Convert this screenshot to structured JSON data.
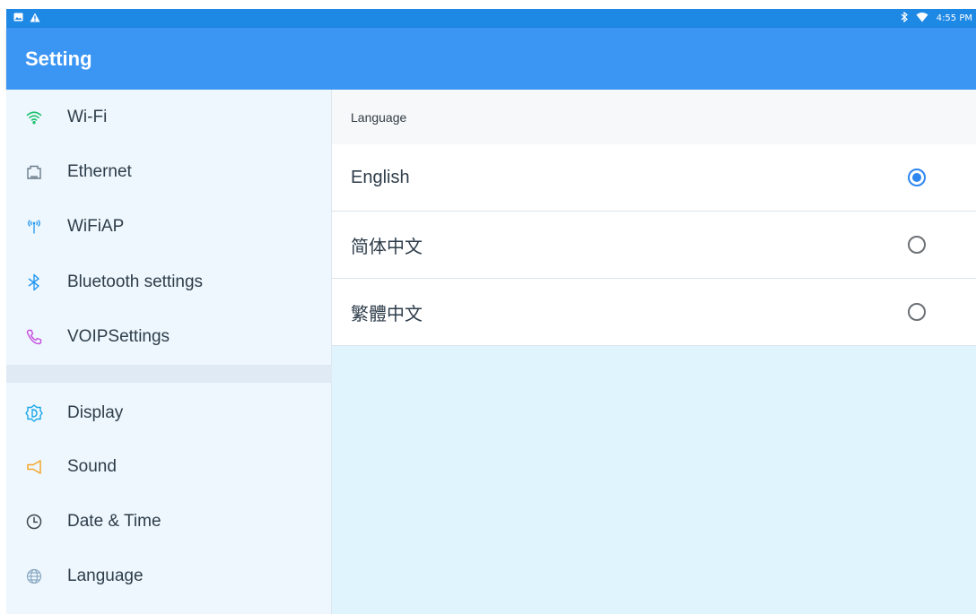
{
  "status_bar": {
    "left_icons": [
      "image-notification-icon",
      "warning-icon"
    ],
    "right_icons": [
      "bluetooth-icon",
      "wifi-signal-icon"
    ],
    "time": "4:55 PM"
  },
  "app_bar": {
    "title": "Setting"
  },
  "sidebar": {
    "items": [
      {
        "label": "Wi-Fi",
        "icon": "wifi-icon",
        "color": "#1ec26e"
      },
      {
        "label": "Ethernet",
        "icon": "ethernet-icon",
        "color": "#6b7b8a"
      },
      {
        "label": "WiFiAP",
        "icon": "hotspot-icon",
        "color": "#2196f3"
      },
      {
        "label": "Bluetooth settings",
        "icon": "bluetooth-icon",
        "color": "#2196f3"
      },
      {
        "label": "VOIPSettings",
        "icon": "phone-icon",
        "color": "#c64ee0"
      },
      {
        "label": "Display",
        "icon": "display-icon",
        "color": "#1aa7e8"
      },
      {
        "label": "Sound",
        "icon": "sound-icon",
        "color": "#f4a52a"
      },
      {
        "label": "Date & Time",
        "icon": "clock-icon",
        "color": "#3a4650"
      },
      {
        "label": "Language",
        "icon": "globe-icon",
        "color": "#8aa8c2"
      }
    ]
  },
  "content": {
    "section_title": "Language",
    "options": [
      {
        "label": "English",
        "selected": true
      },
      {
        "label": "简体中文",
        "selected": false
      },
      {
        "label": "繁體中文",
        "selected": false
      }
    ]
  },
  "colors": {
    "status_bar": "#1e88e5",
    "app_bar": "#3b96f3",
    "sidebar_bg": "#eef7fd",
    "content_bg": "#e0f4fd",
    "radio_accent": "#2e86f0"
  }
}
